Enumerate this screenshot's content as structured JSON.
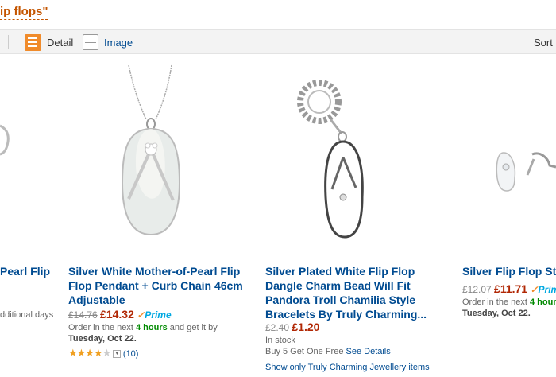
{
  "search": {
    "query_fragment": "ip flops\""
  },
  "viewbar": {
    "detail_label": "Detail",
    "image_label": "Image",
    "sort_label": "Sort b"
  },
  "products": [
    {
      "title_line1": "Pearl Flip",
      "availability": "dditional days"
    },
    {
      "title_line1": "Silver White Mother-of-Pearl Flip",
      "title_line2": "Flop Pendant + Curb Chain 46cm",
      "title_line3": "Adjustable",
      "old_price": "£14.76",
      "price": "£14.32",
      "prime": "Prime",
      "delivery_prefix": "Order in the next",
      "delivery_hours": "4 hours",
      "delivery_suffix": "and get it by",
      "delivery_date": "Tuesday, Oct 22.",
      "rating": 4,
      "review_count": "(10)"
    },
    {
      "title_line1": "Silver Plated White Flip Flop",
      "title_line2": "Dangle Charm Bead Will Fit",
      "title_line3": "Pandora Troll Chamilia Style",
      "title_line4": "Bracelets By Truly Charming...",
      "old_price": "£2.40",
      "price": "£1.20",
      "stock": "In stock",
      "offer_text": "Buy 5 Get One Free",
      "offer_link": "See Details",
      "seller_link": "Show only Truly Charming Jewellery items"
    },
    {
      "title_line1": "Silver Flip Flop St",
      "old_price": "£12.07",
      "price": "£11.71",
      "prime": "Prim",
      "delivery_prefix": "Order in the next",
      "delivery_hours": "4 hour",
      "delivery_date": "Tuesday, Oct 22."
    }
  ],
  "colors": {
    "accent": "#f08b2b",
    "link": "#004b91",
    "price": "#b12704",
    "instock_green": "#008a00"
  }
}
